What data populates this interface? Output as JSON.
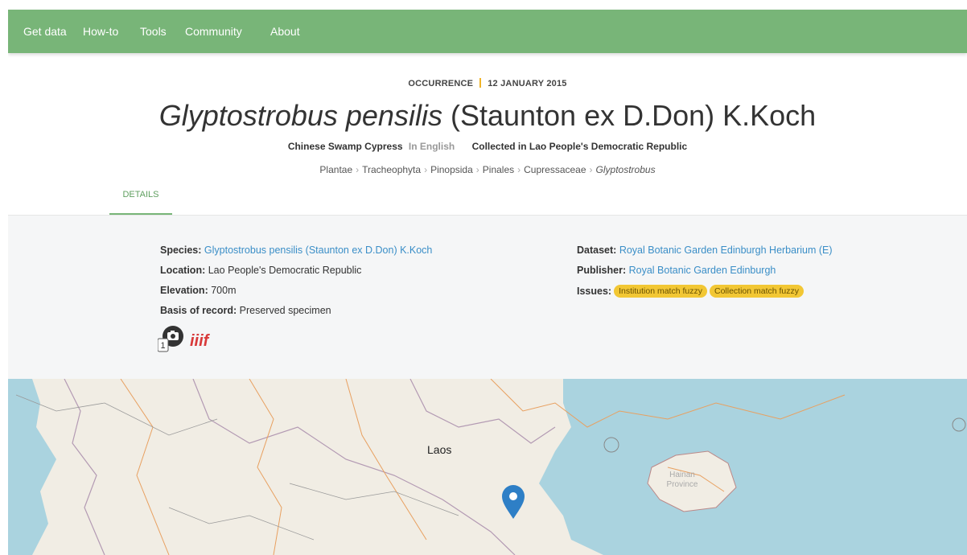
{
  "nav": {
    "items": [
      "Get data",
      "How-to",
      "Tools",
      "Community",
      "About"
    ],
    "bg_color": "#78b578"
  },
  "header": {
    "kicker_type": "OCCURRENCE",
    "kicker_date": "12 JANUARY 2015",
    "title_genus_species": "Glyptostrobus pensilis",
    "title_author": "(Staunton ex D.Don) K.Koch",
    "vernacular_name": "Chinese Swamp Cypress",
    "vernacular_lang": "In English",
    "collected_in": "Collected in Lao People's Democratic Republic",
    "taxonomy": [
      "Plantae",
      "Tracheophyta",
      "Pinopsida",
      "Pinales",
      "Cupressaceae",
      "Glyptostrobus"
    ]
  },
  "tabs": {
    "details": "DETAILS"
  },
  "details": {
    "species_label": "Species:",
    "species_value": "Glyptostrobus pensilis (Staunton ex D.Don) K.Koch",
    "location_label": "Location:",
    "location_value": "Lao People's Democratic Republic",
    "elevation_label": "Elevation:",
    "elevation_value": "700m",
    "basis_label": "Basis of record:",
    "basis_value": "Preserved specimen",
    "dataset_label": "Dataset:",
    "dataset_value": "Royal Botanic Garden Edinburgh Herbarium (E)",
    "publisher_label": "Publisher:",
    "publisher_value": "Royal Botanic Garden Edinburgh",
    "issues_label": "Issues:",
    "issues": [
      "Institution match fuzzy",
      "Collection match fuzzy"
    ],
    "image_count": "1",
    "iiif_logo": "iiif"
  },
  "map": {
    "country_label": "Laos",
    "province_label": "Hainan Province",
    "marker_icon": "map-pin-icon",
    "marker_color": "#2e7fc6"
  }
}
